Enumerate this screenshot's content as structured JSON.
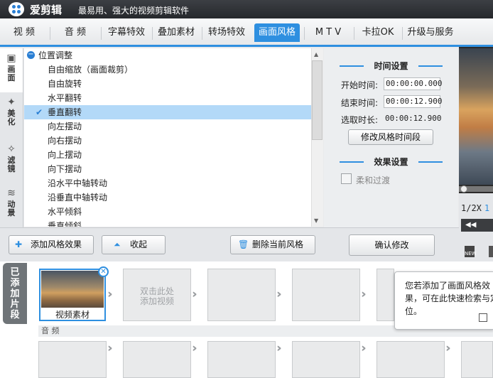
{
  "app": {
    "name": "爱剪辑",
    "slogan": "最易用、强大的视频剪辑软件"
  },
  "tabs": [
    {
      "label": "视 频",
      "active": false
    },
    {
      "label": "音 频",
      "active": false
    },
    {
      "label": "字幕特效",
      "active": false
    },
    {
      "label": "叠加素材",
      "active": false
    },
    {
      "label": "转场特效",
      "active": false
    },
    {
      "label": "画面风格",
      "active": true
    },
    {
      "label": "M T V",
      "active": false
    },
    {
      "label": "卡拉OK",
      "active": false
    },
    {
      "label": "升级与服务",
      "active": false
    }
  ],
  "sidebar": [
    {
      "label": "画面",
      "icon": "frame-icon",
      "active": true
    },
    {
      "label": "美化",
      "icon": "magic-wand-icon",
      "active": false
    },
    {
      "label": "滤镜",
      "icon": "filter-wand-icon",
      "active": false
    },
    {
      "label": "动景",
      "icon": "waves-icon",
      "active": false
    }
  ],
  "effects": {
    "group": "位置调整",
    "items": [
      "自由缩放（画面裁剪）",
      "自由旋转",
      "水平翻转",
      "垂直翻转",
      "向左摆动",
      "向右摆动",
      "向上摆动",
      "向下摆动",
      "沿水平中轴转动",
      "沿垂直中轴转动",
      "水平倾斜",
      "垂直倾斜"
    ],
    "selected": "垂直翻转"
  },
  "time_settings": {
    "title": "时间设置",
    "start_label": "开始时间:",
    "start_value": "00:00:00.000",
    "end_label": "结束时间:",
    "end_value": "00:00:12.900",
    "duration_label": "选取时长:",
    "duration_value": "00:00:12.900",
    "modify_button": "修改风格时间段"
  },
  "effect_settings": {
    "title": "效果设置",
    "fade_label": "柔和过渡",
    "fade_checked": false
  },
  "actions": {
    "add": "添加风格效果",
    "collapse": "收起",
    "delete": "删除当前风格",
    "confirm": "确认修改"
  },
  "preview": {
    "speed": "1/2X",
    "speed_extra": "1"
  },
  "timeline": {
    "added_label": "已添加片段",
    "clip_label": "视频素材",
    "add_video_hint": "双击此处\n添加视频",
    "audio_label": "音 频"
  },
  "tooltip": {
    "text": "您若添加了画面风格效果，可在此快速检索与定位。"
  },
  "colors": {
    "accent": "#2e8fe0",
    "titlebar": "#2f3236",
    "selection": "#b3d9f8"
  }
}
